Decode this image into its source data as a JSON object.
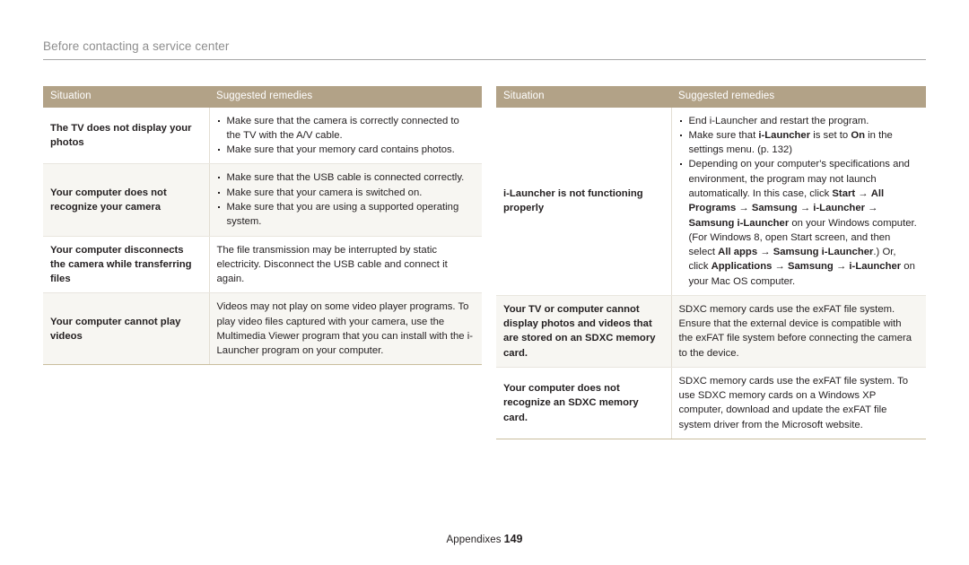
{
  "header": {
    "running_title": "Before contacting a service center"
  },
  "footer": {
    "section": "Appendixes",
    "page_number": "149"
  },
  "colors": {
    "table_header_bg": "#b2a287",
    "table_header_text": "#ffffff",
    "alt_row_bg": "#f7f6f2",
    "row_divider": "#e9e6df",
    "table_bottom_rule": "#c9bd9d",
    "header_rule": "#a7a7a7",
    "running_title_text": "#8e8e8e",
    "body_text": "#231f20"
  },
  "tables": [
    {
      "id": "left-table",
      "columns": [
        "Situation",
        "Suggested remedies"
      ],
      "rows": [
        {
          "situation": "The TV does not display your photos",
          "remedy_type": "bullets",
          "remedy": [
            "Make sure that the camera is correctly connected to the TV with the A/V cable.",
            "Make sure that your memory card contains photos."
          ]
        },
        {
          "situation": "Your computer does not recognize your camera",
          "remedy_type": "bullets",
          "remedy": [
            "Make sure that the USB cable is connected correctly.",
            "Make sure that your camera is switched on.",
            "Make sure that you are using a supported operating system."
          ]
        },
        {
          "situation": "Your computer disconnects the camera while transferring files",
          "remedy_type": "paragraph",
          "remedy": [
            "The file transmission may be interrupted by static electricity. Disconnect the USB cable and connect it again."
          ]
        },
        {
          "situation": "Your computer cannot play videos",
          "remedy_type": "paragraph",
          "remedy": [
            "Videos may not play on some video player programs. To play video files captured with your camera, use the Multimedia Viewer program that you can install with the i-Launcher program on your computer."
          ]
        }
      ]
    },
    {
      "id": "right-table",
      "columns": [
        "Situation",
        "Suggested remedies"
      ],
      "rows": [
        {
          "situation": "i-Launcher is not functioning properly",
          "remedy_type": "bullets_rich",
          "remedy_html": [
            "End i-Launcher and restart the program.",
            "Make sure that <b>i-Launcher</b> is set to <b>On</b> in the settings menu. (p. 132)",
            "Depending on your computer's specifications and environment, the program may not launch automatically. In this case, click <b>Start</b> &#8594; <b>All Programs</b> &#8594; <b>Samsung</b> &#8594; <b>i-Launcher</b> &#8594; <b>Samsung i-Launcher</b> on your Windows computer. (For Windows 8, open Start screen, and then select <b>All apps</b> &#8594; <b>Samsung i-Launcher</b>.) Or, click <b>Applications</b> &#8594; <b>Samsung</b> &#8594; <b>i-Launcher</b> on your Mac OS computer."
          ]
        },
        {
          "situation": "Your TV or computer cannot display photos and videos that are stored on an SDXC memory card.",
          "remedy_type": "paragraph",
          "remedy_html": [
            "SDXC memory cards use the exFAT file system. Ensure that the external device is compatible with the exFAT file system before connecting the camera to the device."
          ]
        },
        {
          "situation": "Your computer does not recognize an SDXC memory card.",
          "remedy_type": "paragraph",
          "remedy_html": [
            "SDXC memory cards use the exFAT file system. To use SDXC memory cards on a Windows XP computer, download and update the exFAT file system driver from the Microsoft website."
          ]
        }
      ]
    }
  ]
}
